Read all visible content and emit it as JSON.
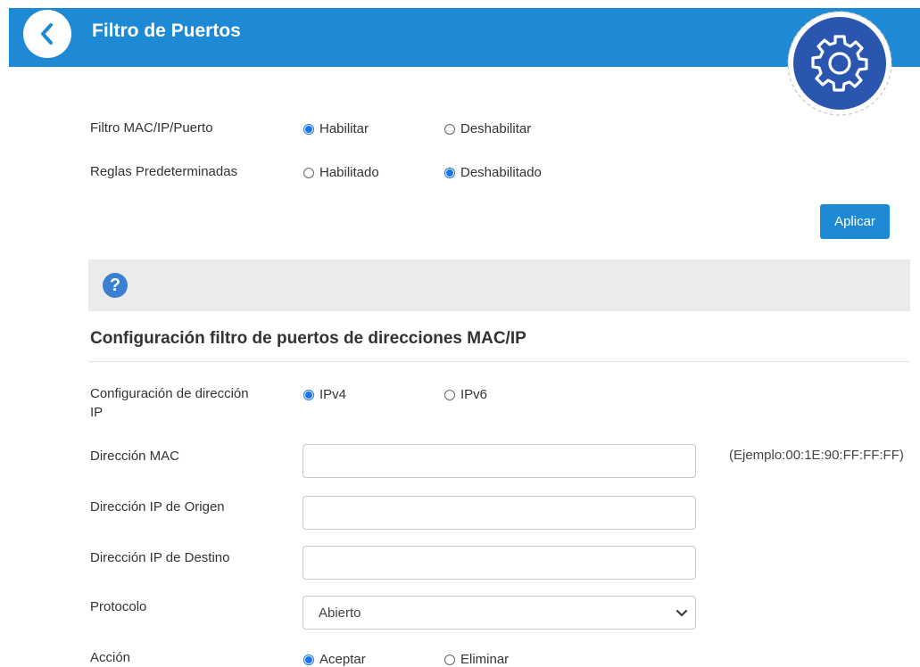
{
  "header": {
    "title": "Filtro de Puertos",
    "accent": "#1e8ad6",
    "back_icon": "chevron-left-icon",
    "settings_icon": "gear-icon"
  },
  "filter": {
    "label": "Filtro MAC/IP/Puerto",
    "options": [
      "Habilitar",
      "Deshabilitar"
    ],
    "selected": "Habilitar"
  },
  "default_rules": {
    "label": "Reglas Predeterminadas",
    "options": [
      "Habilitado",
      "Deshabilitado"
    ],
    "selected": "Deshabilitado"
  },
  "apply_label": "Aplicar",
  "help_icon": "question-icon",
  "section": {
    "title": "Configuración filtro de puertos de direcciones MAC/IP",
    "ip_config": {
      "label_line1": "Configuración de dirección",
      "label_line2": "IP",
      "options": [
        "IPv4",
        "IPv6"
      ],
      "selected": "IPv4"
    },
    "mac": {
      "label": "Dirección MAC",
      "value": "",
      "hint": "(Ejemplo:00:1E:90:FF:FF:FF)"
    },
    "src_ip": {
      "label": "Dirección IP de Origen",
      "value": ""
    },
    "dst_ip": {
      "label": "Dirección IP de Destino",
      "value": ""
    },
    "protocol": {
      "label": "Protocolo",
      "value": "Abierto"
    },
    "action": {
      "label": "Acción",
      "options": [
        "Aceptar",
        "Eliminar"
      ],
      "selected": "Aceptar"
    }
  }
}
